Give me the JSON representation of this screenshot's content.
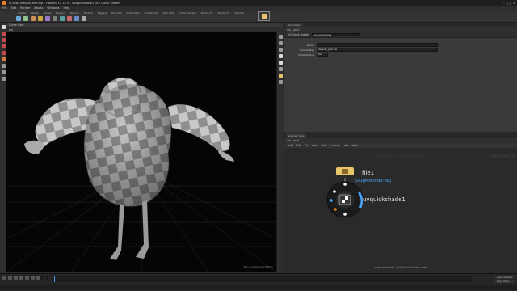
{
  "window": {
    "title": "E:/Test_Files/uv_test.hip - Houdini FX 17.5 - uvquickshade1 (UV Quick Shade)"
  },
  "menubar": {
    "items": [
      "File",
      "Edit",
      "Render",
      "Assets",
      "Windows",
      "Help"
    ]
  },
  "shelf": {
    "tabs": [
      "Create",
      "Modify",
      "Model",
      "Polygon",
      "Deform",
      "Texture",
      "Rigging",
      "Muscles",
      "Characters",
      "Constraints",
      "Hair Utils",
      "Guide Process",
      "Terrain FX",
      "Simple FX",
      "Volume"
    ]
  },
  "viewport": {
    "tab": "Scene View",
    "path": "obj",
    "corner_label": "Non-Commercial Edition"
  },
  "params": {
    "node_type": "UV Quick Shade",
    "node_name": "uvquickshade1",
    "fields": [
      {
        "label": "Group",
        "value": ""
      },
      {
        "label": "Texture Map",
        "value": "default_grid.pic"
      },
      {
        "label": "Show Texture",
        "value": "On"
      }
    ]
  },
  "network": {
    "path": "obj / geo1",
    "menus": [
      "Add",
      "Edit",
      "Go",
      "View",
      "Tools",
      "Layout",
      "Labs",
      "Help"
    ],
    "context_label": "Non-Commercial Edition",
    "geo_label": "Geometry",
    "nodes": {
      "file_name": "file1",
      "file_sub": "SlugMonster.obj",
      "shade_name": "uvquickshade1"
    },
    "footer": "uvquickshade1 (UV Quick Shade) node"
  },
  "timeline": {
    "frame": "1",
    "right_buttons": [
      "Auto Update",
      "Keys Only"
    ]
  },
  "colors": {
    "accent_orange": "#e87d1e",
    "node_blue": "#4aa8ff",
    "file_node_yellow": "#e8c46a"
  }
}
